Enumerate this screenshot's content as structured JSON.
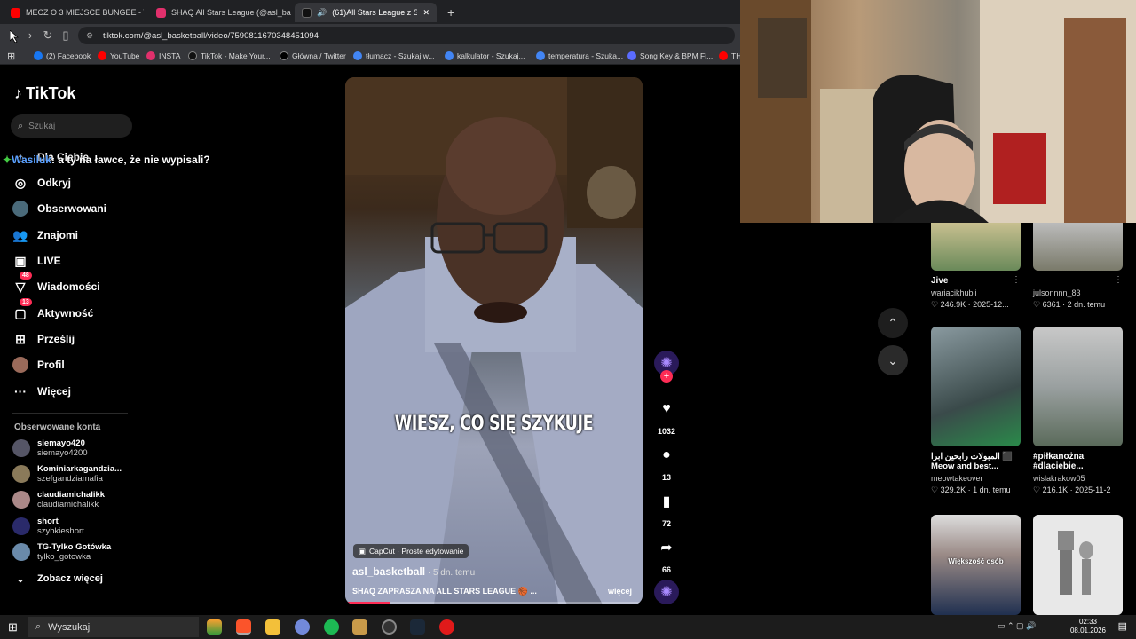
{
  "browser": {
    "tabs": [
      {
        "label": "MECZ O 3 MIEJSCE BUNGEE - T7 SCI",
        "color": "#ff0000"
      },
      {
        "label": "SHAQ All Stars League (@asl_basket",
        "color": "#e1306c"
      },
      {
        "label": "(61)All Stars League z Shaquill",
        "color": "#111111"
      }
    ],
    "new_tab": "+",
    "url": "tiktok.com/@asl_basketball/video/7590811670348451094",
    "bookmarks": [
      {
        "label": "(2) Facebook",
        "color": "#1877f2"
      },
      {
        "label": "YouTube",
        "color": "#ff0000"
      },
      {
        "label": "INSTA",
        "color": "#e1306c"
      },
      {
        "label": "TikTok - Make Your...",
        "color": "#111111"
      },
      {
        "label": "Główna / Twitter",
        "color": "#000000"
      },
      {
        "label": "tłumacz - Szukaj w...",
        "color": "#4285f4"
      },
      {
        "label": "kalkulator - Szukaj...",
        "color": "#4285f4"
      },
      {
        "label": "temperatura - Szuka...",
        "color": "#4285f4"
      },
      {
        "label": "Song Key & BPM Fi...",
        "color": "#5b6cff"
      },
      {
        "label": "TH",
        "color": "#ff0000"
      }
    ]
  },
  "sidebar": {
    "logo": "TikTok",
    "search_placeholder": "Szukaj",
    "items": [
      {
        "label": "Dla Ciebie",
        "icon": "home-icon"
      },
      {
        "label": "Odkryj",
        "icon": "compass-icon"
      },
      {
        "label": "Obserwowani",
        "icon": "following-icon"
      },
      {
        "label": "Znajomi",
        "icon": "friends-icon"
      },
      {
        "label": "LIVE",
        "icon": "live-icon"
      },
      {
        "label": "Wiadomości",
        "icon": "inbox-icon",
        "badge": "48"
      },
      {
        "label": "Aktywność",
        "icon": "activity-icon",
        "badge": "13"
      },
      {
        "label": "Prześlij",
        "icon": "upload-icon"
      },
      {
        "label": "Profil",
        "icon": "profile-icon"
      },
      {
        "label": "Więcej",
        "icon": "more-icon"
      }
    ],
    "followed_title": "Obserwowane konta",
    "accounts": [
      {
        "name": "siemayo420",
        "handle": "siemayo4200",
        "color": "#556"
      },
      {
        "name": "Kominiarkagandzia...",
        "handle": "szefgandziamafia",
        "color": "#8a7a5a"
      },
      {
        "name": "claudiamichalikk",
        "handle": "claudiamichalikk",
        "color": "#a88"
      },
      {
        "name": "short",
        "handle": "szybkieshort",
        "color": "#2a2a6a"
      },
      {
        "name": "TG-Tylko Gotówka",
        "handle": "tylko_gotowka",
        "color": "#6a8aaa"
      }
    ],
    "see_more": "Zobacz więcej",
    "chat_user": "Wasiluk",
    "chat_message": ": a ty na ławce, że nie wypisali?"
  },
  "video": {
    "caption": "WIESZ, CO SIĘ SZYKUJE",
    "capcut": "CapCut · Proste edytowanie",
    "author": "asl_basketball",
    "time": " · 5 dn. temu",
    "description": "SHAQ ZAPRASZA NA ALL STARS LEAGUE 🏀 ...",
    "more": "więcej",
    "progress": 0.15
  },
  "actions": {
    "likes": "1032",
    "comments": "13",
    "saves": "72",
    "shares": "66"
  },
  "grid": [
    {
      "title": "Jive",
      "user": "wariacikhubii",
      "likes": "246.9K",
      "date": "2025-12...",
      "color": "#c8c090"
    },
    {
      "title": "",
      "user": "julsonnnn_83",
      "likes": "6361",
      "date": "2 dn. temu",
      "color": "#8c8c8c"
    },
    {
      "title": "المبولات رابحين ابرا ⬛ Meow and best...",
      "user": "meowtakeover",
      "likes": "329.2K",
      "date": "1 dn. temu",
      "color": "#6a7a7a"
    },
    {
      "title": "#piłkanożna #dlaciebie...",
      "user": "wislakrakow05",
      "likes": "216.1K",
      "date": "2025-11-2",
      "color": "#6a7a6a"
    },
    {
      "title": "",
      "thumb_text": "Większość osób",
      "color": "#9a8a86"
    },
    {
      "title": "",
      "color": "#e8e8e8"
    }
  ],
  "taskbar": {
    "search": "Wyszukaj",
    "time": "02:33",
    "date": "08.01.2026"
  }
}
